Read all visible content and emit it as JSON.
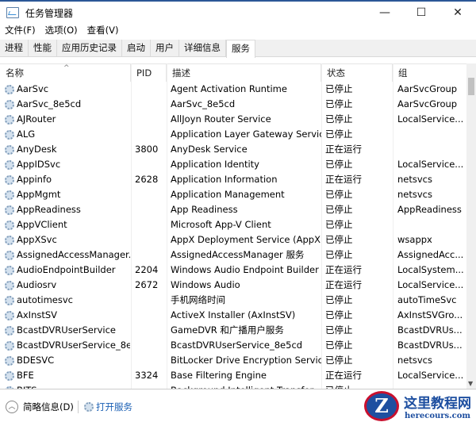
{
  "window": {
    "title": "任务管理器",
    "minimize": "—",
    "maximize": "☐",
    "close": "✕"
  },
  "menu": [
    "文件(F)",
    "选项(O)",
    "查看(V)"
  ],
  "tabs": [
    "进程",
    "性能",
    "应用历史记录",
    "启动",
    "用户",
    "详细信息",
    "服务"
  ],
  "columns": [
    "名称",
    "PID",
    "描述",
    "状态",
    "组"
  ],
  "rows": [
    [
      "AarSvc",
      "",
      "Agent Activation Runtime",
      "已停止",
      "AarSvcGroup"
    ],
    [
      "AarSvc_8e5cd",
      "",
      "AarSvc_8e5cd",
      "已停止",
      "AarSvcGroup"
    ],
    [
      "AJRouter",
      "",
      "AllJoyn Router Service",
      "已停止",
      "LocalService..."
    ],
    [
      "ALG",
      "",
      "Application Layer Gateway Service",
      "已停止",
      ""
    ],
    [
      "AnyDesk",
      "3800",
      "AnyDesk Service",
      "正在运行",
      ""
    ],
    [
      "AppIDSvc",
      "",
      "Application Identity",
      "已停止",
      "LocalService..."
    ],
    [
      "Appinfo",
      "2628",
      "Application Information",
      "正在运行",
      "netsvcs"
    ],
    [
      "AppMgmt",
      "",
      "Application Management",
      "已停止",
      "netsvcs"
    ],
    [
      "AppReadiness",
      "",
      "App Readiness",
      "已停止",
      "AppReadiness"
    ],
    [
      "AppVClient",
      "",
      "Microsoft App-V Client",
      "已停止",
      ""
    ],
    [
      "AppXSvc",
      "",
      "AppX Deployment Service (AppX...",
      "已停止",
      "wsappx"
    ],
    [
      "AssignedAccessManager...",
      "",
      "AssignedAccessManager 服务",
      "已停止",
      "AssignedAcc..."
    ],
    [
      "AudioEndpointBuilder",
      "2204",
      "Windows Audio Endpoint Builder",
      "正在运行",
      "LocalSystem..."
    ],
    [
      "Audiosrv",
      "2672",
      "Windows Audio",
      "正在运行",
      "LocalService..."
    ],
    [
      "autotimesvc",
      "",
      "手机网络时间",
      "已停止",
      "autoTimeSvc"
    ],
    [
      "AxInstSV",
      "",
      "ActiveX Installer (AxInstSV)",
      "已停止",
      "AxInstSVGro..."
    ],
    [
      "BcastDVRUserService",
      "",
      "GameDVR 和广播用户服务",
      "已停止",
      "BcastDVRUs..."
    ],
    [
      "BcastDVRUserService_8e...",
      "",
      "BcastDVRUserService_8e5cd",
      "已停止",
      "BcastDVRUs..."
    ],
    [
      "BDESVC",
      "",
      "BitLocker Drive Encryption Service",
      "已停止",
      "netsvcs"
    ],
    [
      "BFE",
      "3324",
      "Base Filtering Engine",
      "正在运行",
      "LocalService..."
    ],
    [
      "BITS",
      "",
      "Background Intelligent Transfer...",
      "已停止",
      ""
    ]
  ],
  "footer": {
    "fewer_details": "简略信息(D)",
    "open_services": "打开服务"
  },
  "watermark": {
    "name": "这里教程网",
    "site": "herecours.com"
  }
}
